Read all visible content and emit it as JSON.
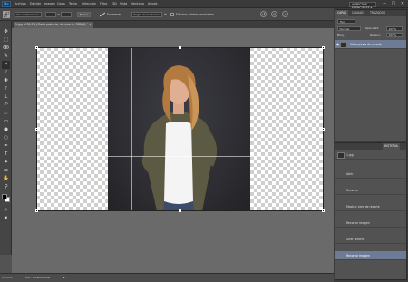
{
  "app": {
    "logo_text": "Ps"
  },
  "menu": [
    "Archivo",
    "Edición",
    "Imagen",
    "Capa",
    "Texto",
    "Selección",
    "Filtro",
    "3D",
    "Vista",
    "Ventana",
    "Ayuda"
  ],
  "workspace": {
    "label": "ASPECTOS ESENCIALES ▾"
  },
  "window_controls": {
    "minimize": "−",
    "restore": "□",
    "close": "✕"
  },
  "options_bar": {
    "ratio_value": "Sin restricciones",
    "width_value": "",
    "height_value": "",
    "clear_label": "Borrar",
    "straighten_label": "Enderezar",
    "overlay_value": "Regla de los tercios",
    "delete_cropped_label": "Eliminar píxeles recortados"
  },
  "document_tab": {
    "title": "1.jpg al 33,3% (Modo posterior de recorte, RGB/8) *",
    "close": "×"
  },
  "status": {
    "zoom": "33,33%",
    "doc_info": "Doc: 6,59M/6,59M"
  },
  "swatch_colors": {
    "foreground": "#000000",
    "background": "#ffffff"
  },
  "tools": [
    "move-icon",
    "marquee-icon",
    "lasso-icon",
    "quick-select-icon",
    "crop-icon",
    "eyedropper-icon",
    "heal-icon",
    "brush-icon",
    "stamp-icon",
    "history-brush-icon",
    "eraser-icon",
    "gradient-icon",
    "blur-icon",
    "dodge-icon",
    "pen-icon",
    "type-icon",
    "path-select-icon",
    "shape-icon",
    "hand-icon",
    "zoom-icon"
  ],
  "layers_panel": {
    "tabs": [
      "CAPAS",
      "CANALES",
      "TRAZADOS"
    ],
    "kind_value": "Tipo",
    "blend_value": "Normal",
    "opacity_label": "Opacidad:",
    "opacity_value": "100%",
    "lock_label": "Bloq.:",
    "fill_label": "Relleno:",
    "fill_value": "100%",
    "layer_name": "Vista previa de recorte"
  },
  "history_panel": {
    "tabs": [
      "HISTORIA"
    ],
    "snapshot_name": "1.jpg",
    "entries": [
      "Abrir",
      "Recortar",
      "Mostrar área de recorte",
      "Recortar imagen",
      "Girar recorte",
      "Recortar imagen"
    ]
  }
}
